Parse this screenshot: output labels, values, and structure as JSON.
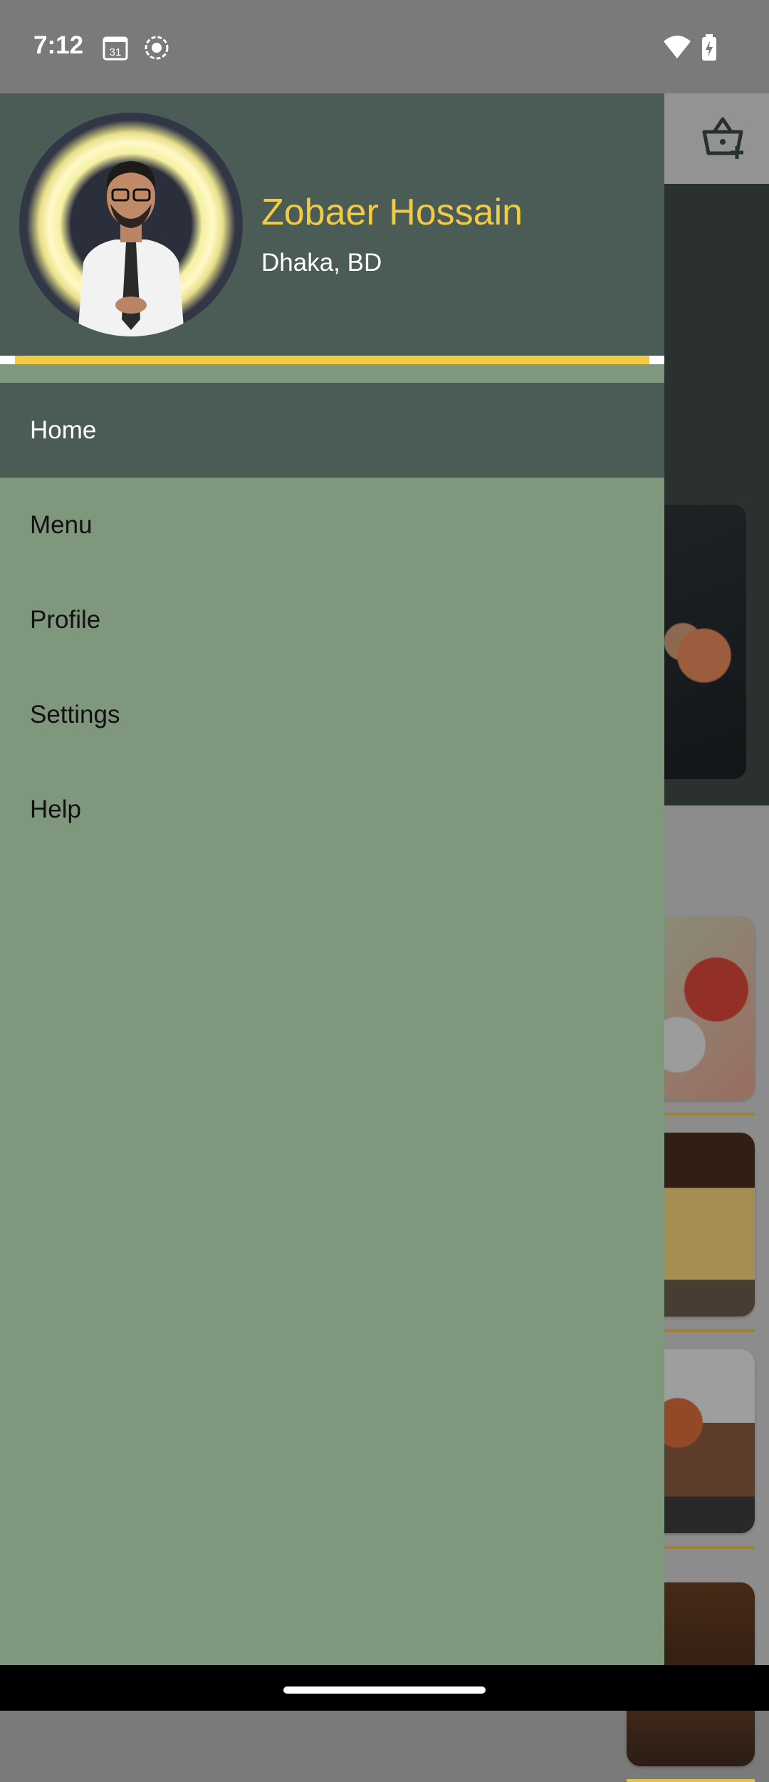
{
  "status_bar": {
    "time": "7:12",
    "calendar_day": "31",
    "icons": [
      "calendar-icon",
      "screen-record-icon",
      "wifi-icon",
      "battery-charging-icon"
    ]
  },
  "background_app": {
    "cart_icon": "basket-add-icon"
  },
  "drawer": {
    "user_name": "Zobaer Hossain",
    "user_location": "Dhaka, BD",
    "accent_color": "#f2cb44",
    "header_color": "#4b5b55",
    "body_color": "#7f977d",
    "items": [
      {
        "label": "Home",
        "active": true
      },
      {
        "label": "Menu",
        "active": false
      },
      {
        "label": "Profile",
        "active": false
      },
      {
        "label": "Settings",
        "active": false
      },
      {
        "label": "Help",
        "active": false
      }
    ]
  }
}
